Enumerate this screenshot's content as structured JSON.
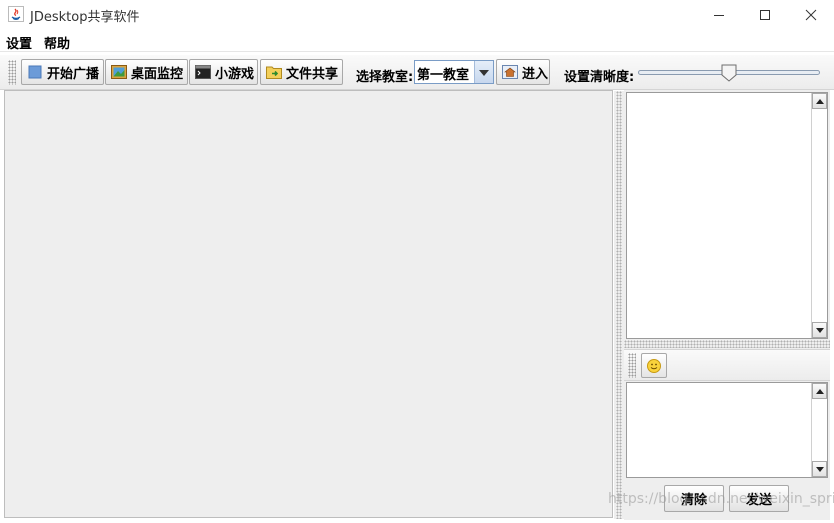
{
  "window": {
    "title": "JDesktop共享软件"
  },
  "menu": {
    "items": [
      "设置",
      "帮助"
    ]
  },
  "toolbar": {
    "broadcast_label": "开始广播",
    "monitor_label": "桌面监控",
    "game_label": "小游戏",
    "fileshare_label": "文件共享",
    "classroom_label": "选择教室:",
    "classroom_selected": "第一教室",
    "enter_label": "进入",
    "clarity_label": "设置清晰度:",
    "clarity_value_fraction": 0.5
  },
  "chat": {
    "clear_label": "清除",
    "send_label": "发送"
  },
  "watermark": "https://blog.csdn.net/weixin_springs",
  "colors": {
    "accent": "#7a9cc6",
    "panel_bg": "#eeeeee"
  }
}
